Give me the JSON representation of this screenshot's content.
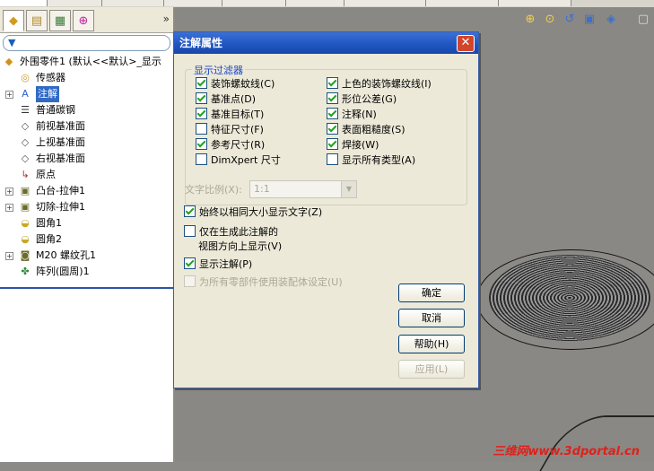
{
  "feature_manager": {
    "more_glyph": "»",
    "tree": [
      {
        "label": "外围零件1   (默认<<默认>_显示",
        "icon": "part-icon",
        "expander": false,
        "highlight": false
      },
      {
        "label": "传感器",
        "icon": "sensor-icon",
        "expander": false,
        "highlight": false
      },
      {
        "label": "注解",
        "icon": "annotation-icon",
        "expander": true,
        "highlight": true
      },
      {
        "label": "普通碳钢",
        "icon": "material-icon",
        "expander": false,
        "highlight": false
      },
      {
        "label": "前视基准面",
        "icon": "plane-icon",
        "expander": false,
        "highlight": false
      },
      {
        "label": "上视基准面",
        "icon": "plane-icon",
        "expander": false,
        "highlight": false
      },
      {
        "label": "右视基准面",
        "icon": "plane-icon",
        "expander": false,
        "highlight": false
      },
      {
        "label": "原点",
        "icon": "origin-icon",
        "expander": false,
        "highlight": false
      },
      {
        "label": "凸台-拉伸1",
        "icon": "extrude-icon",
        "expander": true,
        "highlight": false
      },
      {
        "label": "切除-拉伸1",
        "icon": "cut-icon",
        "expander": true,
        "highlight": false
      },
      {
        "label": "圆角1",
        "icon": "fillet-icon",
        "expander": false,
        "highlight": false
      },
      {
        "label": "圆角2",
        "icon": "fillet-icon",
        "expander": false,
        "highlight": false
      },
      {
        "label": "M20 螺纹孔1",
        "icon": "hole-icon",
        "expander": true,
        "highlight": false
      },
      {
        "label": "阵列(圆周)1",
        "icon": "pattern-icon",
        "expander": false,
        "highlight": false
      }
    ]
  },
  "dialog": {
    "title": "注解属性",
    "close_glyph": "✕",
    "filter_group_title": "显示过滤器",
    "filters_left": [
      {
        "label": "装饰螺蚊线(C)",
        "checked": true
      },
      {
        "label": "基准点(D)",
        "checked": true
      },
      {
        "label": "基准目标(T)",
        "checked": true
      },
      {
        "label": "特征尺寸(F)",
        "checked": false
      },
      {
        "label": "参考尺寸(R)",
        "checked": true
      },
      {
        "label": "DimXpert 尺寸",
        "checked": false
      }
    ],
    "filters_right": [
      {
        "label": "上色的装饰螺纹线(I)",
        "checked": true
      },
      {
        "label": "形位公差(G)",
        "checked": true
      },
      {
        "label": "注释(N)",
        "checked": true
      },
      {
        "label": "表面粗糙度(S)",
        "checked": true
      },
      {
        "label": "焊接(W)",
        "checked": true
      },
      {
        "label": "显示所有类型(A)",
        "checked": false
      }
    ],
    "text_scale_label": "文字比例(X):",
    "text_scale_value": "1:1",
    "options": [
      {
        "label": "始终以相同大小显示文字(Z)",
        "checked": true,
        "disabled": false
      },
      {
        "label": "仅在生成此注解的",
        "checked": false,
        "disabled": false
      },
      {
        "label": "视图方向上显示(V)",
        "checked": null,
        "disabled": false
      },
      {
        "label": "显示注解(P)",
        "checked": true,
        "disabled": false
      },
      {
        "label": "为所有零部件使用装配体设定(U)",
        "checked": false,
        "disabled": true
      }
    ],
    "buttons": {
      "ok": "确定",
      "cancel": "取消",
      "help": "帮助(H)",
      "apply": "应用(L)"
    }
  },
  "watermark": "三维网www.3dportal.cn"
}
